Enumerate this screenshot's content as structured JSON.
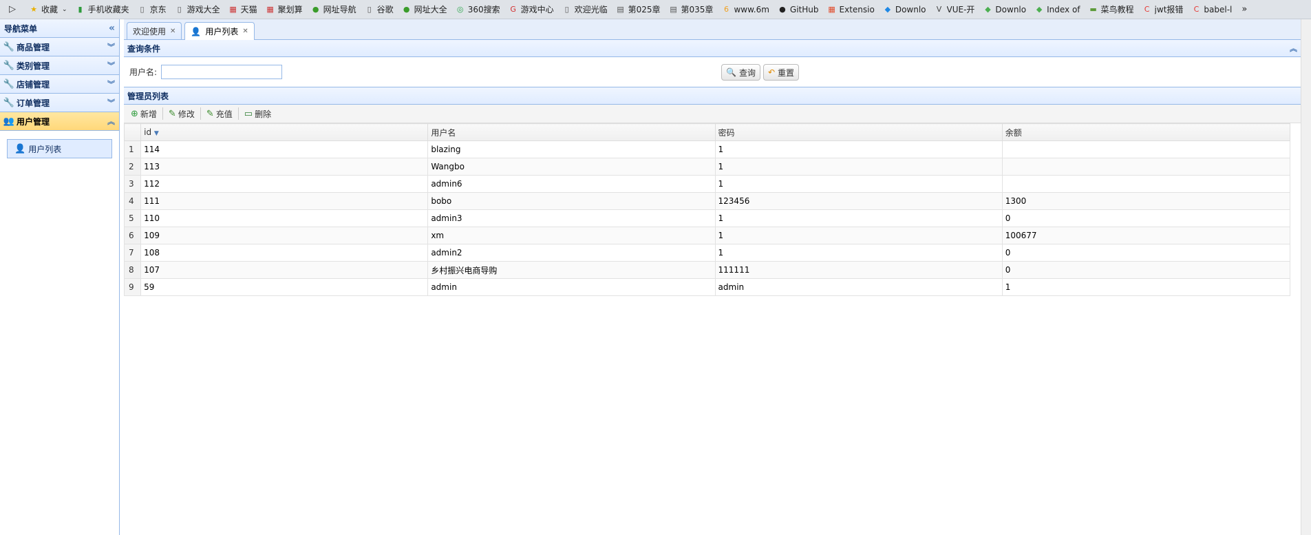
{
  "bookmarks": {
    "items": [
      {
        "label": "收藏",
        "icon": "star-icon",
        "color": "#e8b000"
      },
      {
        "label": "手机收藏夹",
        "icon": "phone-icon",
        "color": "#2e9b3c"
      },
      {
        "label": "京东",
        "icon": "page-icon",
        "color": "#555555"
      },
      {
        "label": "游戏大全",
        "icon": "page-icon",
        "color": "#555555"
      },
      {
        "label": "天猫",
        "icon": "tmall-icon",
        "color": "#c33"
      },
      {
        "label": "聚划算",
        "icon": "juhuasuan-icon",
        "color": "#c33"
      },
      {
        "label": "网址导航",
        "icon": "nav-icon",
        "color": "#3a9c2a"
      },
      {
        "label": "谷歌",
        "icon": "page-icon",
        "color": "#555555"
      },
      {
        "label": "网址大全",
        "icon": "nav-icon",
        "color": "#3a9c2a"
      },
      {
        "label": "360搜索",
        "icon": "search360-icon",
        "color": "#2fa84f"
      },
      {
        "label": "游戏中心",
        "icon": "game-icon",
        "color": "#d32f2f"
      },
      {
        "label": "欢迎光临",
        "icon": "page-icon",
        "color": "#555555"
      },
      {
        "label": "第025章",
        "icon": "book-icon",
        "color": "#555555"
      },
      {
        "label": "第035章",
        "icon": "book-icon",
        "color": "#555555"
      },
      {
        "label": "www.6m",
        "icon": "six-icon",
        "color": "#f0a020"
      },
      {
        "label": "GitHub",
        "icon": "github-icon",
        "color": "#222222"
      },
      {
        "label": "Extensio",
        "icon": "windows-icon",
        "color": "#e04a2a"
      },
      {
        "label": "Downlo",
        "icon": "vscode-icon",
        "color": "#1e88e5"
      },
      {
        "label": "VUE-开",
        "icon": "vue-icon",
        "color": "#444444"
      },
      {
        "label": "Downlo",
        "icon": "node-icon",
        "color": "#4caf50"
      },
      {
        "label": "Index of",
        "icon": "node-icon",
        "color": "#4caf50"
      },
      {
        "label": "菜鸟教程",
        "icon": "runoob-icon",
        "color": "#5d9b3a"
      },
      {
        "label": "jwt报错",
        "icon": "csdn-icon",
        "color": "#e53935"
      },
      {
        "label": "babel-l",
        "icon": "csdn-icon",
        "color": "#e53935"
      }
    ],
    "more": "»"
  },
  "nav": {
    "title": "导航菜单",
    "sections": [
      {
        "label": "商品管理",
        "active": false
      },
      {
        "label": "类别管理",
        "active": false
      },
      {
        "label": "店铺管理",
        "active": false
      },
      {
        "label": "订单管理",
        "active": false
      },
      {
        "label": "用户管理",
        "active": true
      }
    ],
    "sub_item": "用户列表"
  },
  "tabs": [
    {
      "label": "欢迎使用",
      "active": false
    },
    {
      "label": "用户列表",
      "active": true
    }
  ],
  "query": {
    "title": "查询条件",
    "username_label": "用户名:",
    "username_value": "",
    "search_button": "查询",
    "reset_button": "重置"
  },
  "list": {
    "title": "管理员列表",
    "toolbar": {
      "add": "新增",
      "edit": "修改",
      "recharge": "充值",
      "delete": "删除"
    },
    "columns": [
      "id",
      "用户名",
      "密码",
      "余额"
    ],
    "rows": [
      {
        "n": "1",
        "id": "114",
        "username": "blazing",
        "password": "1",
        "balance": ""
      },
      {
        "n": "2",
        "id": "113",
        "username": "Wangbo",
        "password": "1",
        "balance": ""
      },
      {
        "n": "3",
        "id": "112",
        "username": "admin6",
        "password": "1",
        "balance": ""
      },
      {
        "n": "4",
        "id": "111",
        "username": "bobo",
        "password": "123456",
        "balance": "1300"
      },
      {
        "n": "5",
        "id": "110",
        "username": "admin3",
        "password": "1",
        "balance": "0"
      },
      {
        "n": "6",
        "id": "109",
        "username": "xm",
        "password": "1",
        "balance": "100677"
      },
      {
        "n": "7",
        "id": "108",
        "username": "admin2",
        "password": "1",
        "balance": "0"
      },
      {
        "n": "8",
        "id": "107",
        "username": "乡村振兴电商导购",
        "password": "111111",
        "balance": "0"
      },
      {
        "n": "9",
        "id": "59",
        "username": "admin",
        "password": "admin",
        "balance": "1"
      }
    ]
  }
}
